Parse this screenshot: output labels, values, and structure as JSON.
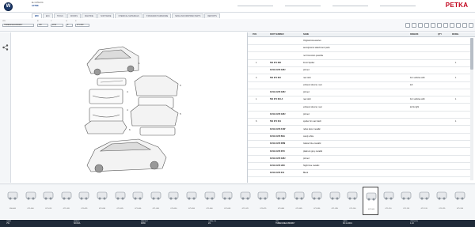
{
  "header": {
    "catalog_label": "EL.CATALOG",
    "catalog_value": "ACTIVE",
    "brand": "PETKA",
    "fields": [
      "",
      "",
      "",
      ""
    ]
  },
  "tabs": [
    {
      "label": "EPC",
      "active": true
    },
    {
      "label": "EKC",
      "active": false
    },
    {
      "label": "TOOLS",
      "active": false
    },
    {
      "label": "WORKS",
      "active": false
    },
    {
      "label": "MACHINE",
      "active": false
    },
    {
      "label": "SOFTWARE",
      "active": false
    },
    {
      "label": "CHEMICAL MATERIALS",
      "active": false
    },
    {
      "label": "STANDARD HARDWARE",
      "active": false
    },
    {
      "label": "NEW AND DROPPED PARTS",
      "active": false
    },
    {
      "label": "REPORTS",
      "active": false
    }
  ],
  "filters": {
    "vin_label": "VIN",
    "vin": "TMBEN4NE1CB00807",
    "brand_label": "B",
    "brand": "VW",
    "year_label": "Y",
    "year": "2012",
    "group_label": "G",
    "group": "8",
    "sub_label": "S",
    "sub": "071-000"
  },
  "table": {
    "headers": {
      "pos": "POS",
      "num": "PART NUMBER",
      "name": "NAME",
      "rem": "REMARK",
      "qty": "QTY",
      "model": "MODEL"
    },
    "rows": [
      {
        "pos": "",
        "num": "",
        "name": "Original Accessories",
        "rem": "",
        "qty": ""
      },
      {
        "pos": "",
        "num": "",
        "name": "aerodynamic attachment parts",
        "rem": "",
        "qty": ""
      },
      {
        "pos": "",
        "num": "",
        "name": "no FI-function possible",
        "rem": "",
        "qty": ""
      },
      {
        "pos": "1",
        "num": "561 071 606",
        "name": "Front Spoiler",
        "rem": "",
        "qty": "1"
      },
      {
        "pos": "",
        "num": "01/11-10/15 GRU",
        "name": "primed",
        "rem": "",
        "qty": ""
      },
      {
        "pos": "4",
        "num": "561 071 610",
        "name": "rear skirt",
        "rem": "For vehicles with",
        "qty": "1"
      },
      {
        "pos": "",
        "num": "",
        "name": "exhaust silencer, rear",
        "rem": "left",
        "qty": ""
      },
      {
        "pos": "",
        "num": "01/11-10/15 GRU",
        "name": "primed",
        "rem": "",
        "qty": ""
      },
      {
        "pos": "1",
        "num": "561 071 610 A",
        "name": "rear skirt",
        "rem": "For vehicles with",
        "qty": "1"
      },
      {
        "pos": "",
        "num": "",
        "name": "exhaust silencer, rear",
        "rem": "left & right",
        "qty": ""
      },
      {
        "pos": "",
        "num": "01/11-10/15 GRU",
        "name": "primed",
        "rem": "",
        "qty": ""
      },
      {
        "pos": "6",
        "num": "561 071 641",
        "name": "spoiler for rear hatch",
        "rem": "",
        "qty": "1"
      },
      {
        "pos": "",
        "num": "01/11-10/15 A7W",
        "name": "reflex silver metallic",
        "rem": "",
        "qty": ""
      },
      {
        "pos": "",
        "num": "01/11-10/15 B4A",
        "name": "candy white",
        "rem": "",
        "qty": ""
      },
      {
        "pos": "",
        "num": "01/11-10/15 D5M",
        "name": "Glacier blue metallic",
        "rem": "",
        "qty": ""
      },
      {
        "pos": "",
        "num": "01/11-10/15 D7X",
        "name": "platinum grey metallic",
        "rem": "",
        "qty": ""
      },
      {
        "pos": "",
        "num": "01/11-10/15 GRU",
        "name": "primed",
        "rem": "",
        "qty": ""
      },
      {
        "pos": "",
        "num": "01/11-10/15 H5X",
        "name": "Night blue metallic",
        "rem": "",
        "qty": ""
      },
      {
        "pos": "",
        "num": "01/11-10/15 041",
        "name": "Black",
        "rem": "",
        "qty": ""
      }
    ]
  },
  "thumbnails": [
    {
      "caption": "050-000",
      "icon": "engine-icon"
    },
    {
      "caption": "071-000",
      "icon": "part-icon"
    },
    {
      "caption": "071-015",
      "icon": "part-icon"
    },
    {
      "caption": "071-020",
      "icon": "part-icon"
    },
    {
      "caption": "071-025",
      "icon": "part-icon"
    },
    {
      "caption": "071-030",
      "icon": "part-icon"
    },
    {
      "caption": "071-035",
      "icon": "part-icon"
    },
    {
      "caption": "071-040",
      "icon": "part-icon"
    },
    {
      "caption": "071-045",
      "icon": "part-icon"
    },
    {
      "caption": "071-050",
      "icon": "part-icon"
    },
    {
      "caption": "071-055",
      "icon": "part-icon"
    },
    {
      "caption": "071-060",
      "icon": "part-icon"
    },
    {
      "caption": "071-065",
      "icon": "part-icon"
    },
    {
      "caption": "071-070",
      "icon": "part-icon"
    },
    {
      "caption": "071-075",
      "icon": "part-icon"
    },
    {
      "caption": "071-080",
      "icon": "part-icon"
    },
    {
      "caption": "071-085",
      "icon": "part-icon"
    },
    {
      "caption": "071-090",
      "icon": "part-icon"
    },
    {
      "caption": "071-095",
      "icon": "part-icon"
    },
    {
      "caption": "071-100",
      "icon": "part-icon"
    },
    {
      "caption": "071-105",
      "icon": "car-icon"
    },
    {
      "caption": "071-110",
      "icon": "part-icon"
    },
    {
      "caption": "071-115",
      "icon": "part-icon"
    },
    {
      "caption": "071-120",
      "icon": "part-icon"
    },
    {
      "caption": "071-125",
      "icon": "part-icon"
    },
    {
      "caption": "071-130",
      "icon": "part-icon"
    }
  ],
  "status": [
    {
      "label": "USER",
      "value": "VW"
    },
    {
      "label": "BRAND",
      "value": "SKODA"
    },
    {
      "label": "MARKET",
      "value": "RDW"
    },
    {
      "label": "CATALOG",
      "value": "2/1"
    },
    {
      "label": "VIN",
      "value": "TMBEN4NE1CB00807"
    },
    {
      "label": "DATE",
      "value": "06.11.2019"
    },
    {
      "label": "VERSION",
      "value": "1.10"
    }
  ],
  "colors": {
    "accent": "#0b3c8c",
    "brand": "#c0001a",
    "status_bg": "#1f2a38"
  }
}
